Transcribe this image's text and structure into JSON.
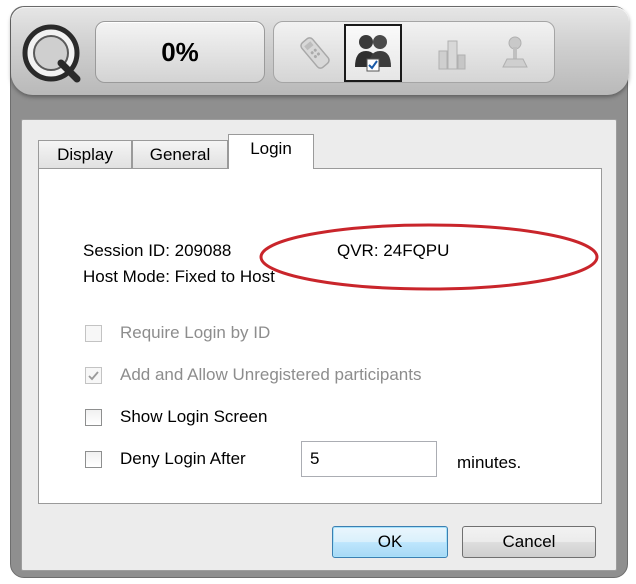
{
  "toolbar": {
    "progress_label": "0%",
    "icons": [
      {
        "name": "remote-clicker-icon",
        "enabled": false
      },
      {
        "name": "participants-icon",
        "enabled": true,
        "selected": true
      },
      {
        "name": "chart-icon",
        "enabled": false
      },
      {
        "name": "joystick-icon",
        "enabled": false
      }
    ]
  },
  "tabs": [
    {
      "label": "Display",
      "active": false
    },
    {
      "label": "General",
      "active": false
    },
    {
      "label": "Login",
      "active": true
    }
  ],
  "login_panel": {
    "session_id": "Session ID: 209088",
    "qvr": "QVR: 24FQPU",
    "host_mode": "Host Mode: Fixed to Host",
    "options": [
      {
        "label": "Require Login by ID",
        "checked": false,
        "enabled": false
      },
      {
        "label": "Add and Allow Unregistered participants",
        "checked": true,
        "enabled": false
      },
      {
        "label": "Show Login Screen",
        "checked": false,
        "enabled": true
      },
      {
        "label": "Deny Login After",
        "checked": false,
        "enabled": true
      }
    ],
    "deny_minutes_value": "5",
    "minutes_label": "minutes."
  },
  "buttons": {
    "ok": "OK",
    "cancel": "Cancel"
  },
  "colors": {
    "annotation_ellipse": "#c9252b",
    "ok_button_border": "#3c7fb1"
  }
}
